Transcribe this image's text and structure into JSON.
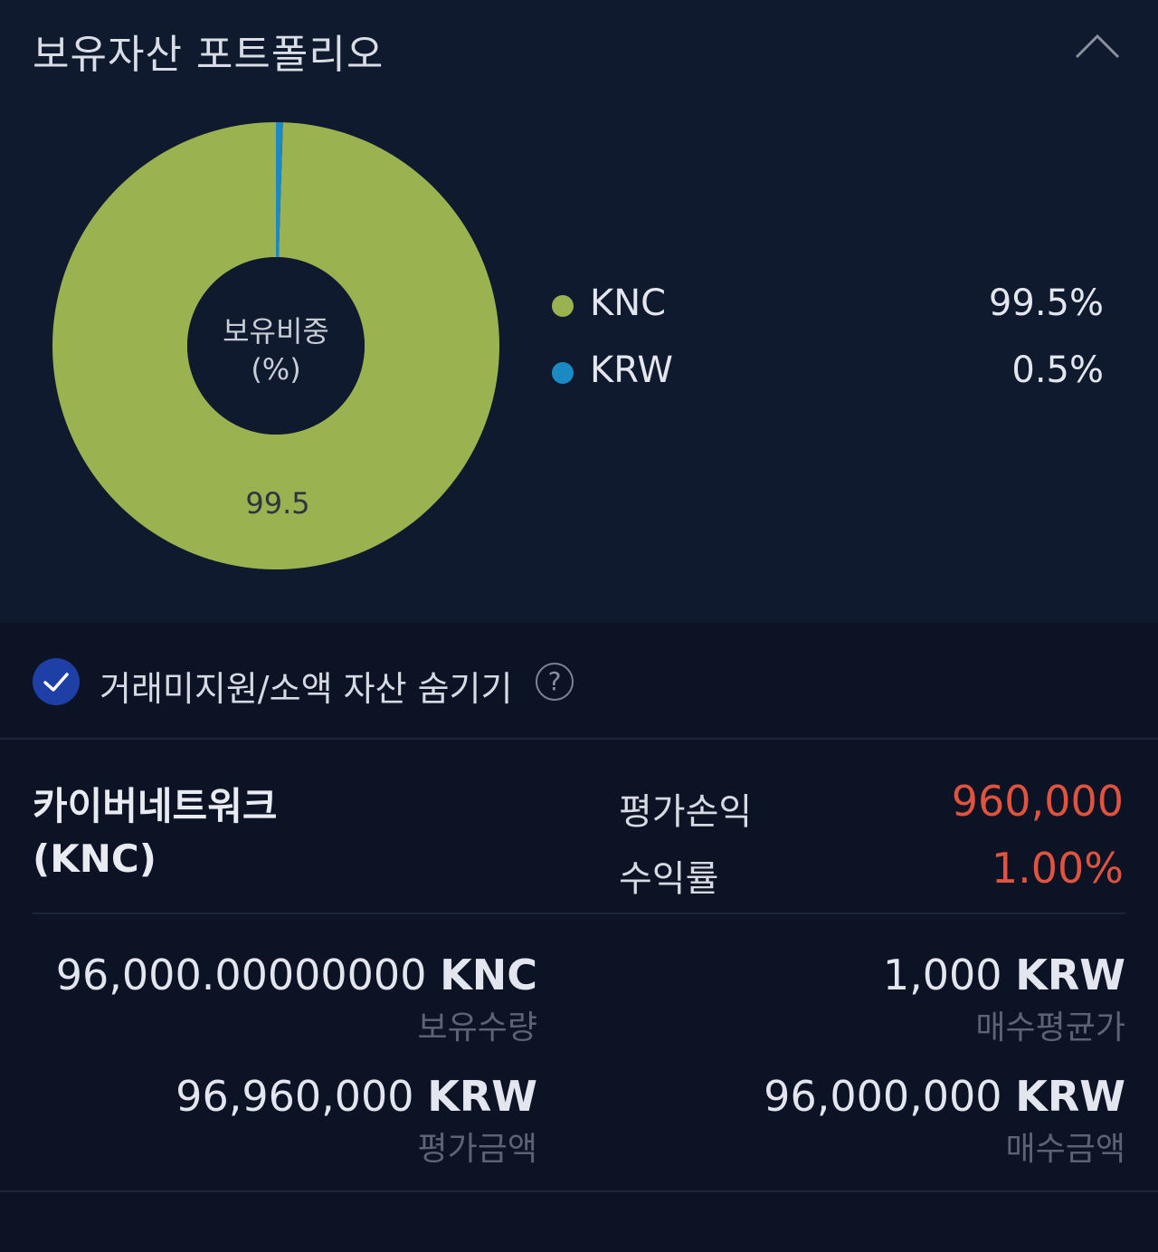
{
  "header": {
    "title": "보유자산 포트폴리오"
  },
  "chart_data": {
    "type": "pie",
    "center_label": [
      "보유비중",
      "(%)"
    ],
    "categories": [
      "KNC",
      "KRW"
    ],
    "values": [
      99.5,
      0.5
    ],
    "slice_labels": [
      "99.5",
      ""
    ],
    "colors": [
      "#9ab250",
      "#1b8ac4"
    ]
  },
  "legend": [
    {
      "name": "KNC",
      "value": "99.5%",
      "color": "#9ab250"
    },
    {
      "name": "KRW",
      "value": "0.5%",
      "color": "#1b8ac4"
    }
  ],
  "filter": {
    "label": "거래미지원/소액 자산 숨기기",
    "checked": true,
    "help": "?"
  },
  "asset": {
    "name_line1": "카이버네트워크",
    "name_line2": "(KNC)",
    "pnl_label": "평가손익",
    "pnl_value": "960,000",
    "return_label": "수익률",
    "return_value": "1.00%",
    "holding_qty": "96,000.00000000",
    "holding_unit": "KNC",
    "holding_label": "보유수량",
    "avg_price": "1,000",
    "avg_unit": "KRW",
    "avg_label": "매수평균가",
    "eval_amount": "96,960,000",
    "eval_unit": "KRW",
    "eval_label": "평가금액",
    "buy_amount": "96,000,000",
    "buy_unit": "KRW",
    "buy_label": "매수금액"
  }
}
